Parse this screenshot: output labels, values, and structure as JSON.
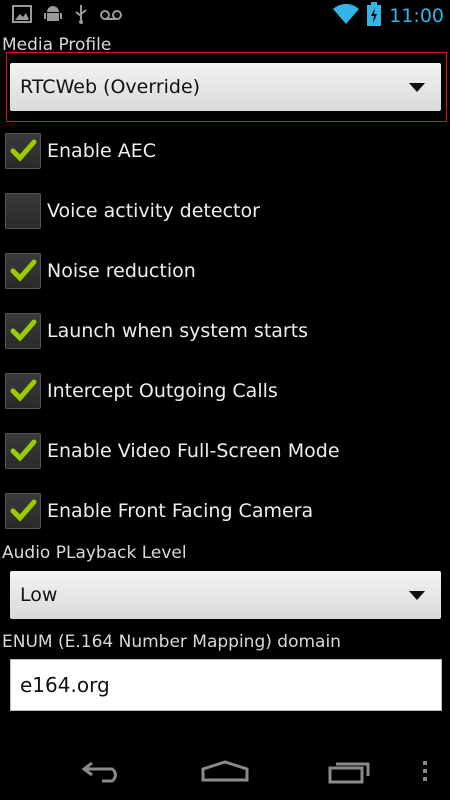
{
  "status_bar": {
    "time": "11:00",
    "left_icons": [
      "image-icon",
      "android-debug-icon",
      "usb-icon",
      "voicemail-icon"
    ],
    "right_icons": [
      "wifi-icon",
      "battery-charging-icon"
    ],
    "accent_color": "#33b5e5"
  },
  "media_profile": {
    "label": "Media Profile",
    "selected": "RTCWeb (Override)"
  },
  "checkboxes": [
    {
      "label": "Enable AEC",
      "checked": true
    },
    {
      "label": "Voice activity detector",
      "checked": false
    },
    {
      "label": "Noise reduction",
      "checked": true
    },
    {
      "label": "Launch when system starts",
      "checked": true
    },
    {
      "label": "Intercept Outgoing Calls",
      "checked": true
    },
    {
      "label": "Enable Video Full-Screen Mode",
      "checked": true
    },
    {
      "label": "Enable Front Facing Camera",
      "checked": true
    }
  ],
  "audio_level": {
    "label": "Audio PLayback Level",
    "selected": "Low"
  },
  "enum_domain": {
    "label": "ENUM (E.164 Number Mapping) domain",
    "value": "e164.org"
  },
  "nav_bar": {
    "icons": [
      "back-icon",
      "home-icon",
      "recent-apps-icon",
      "overflow-menu-icon"
    ]
  }
}
